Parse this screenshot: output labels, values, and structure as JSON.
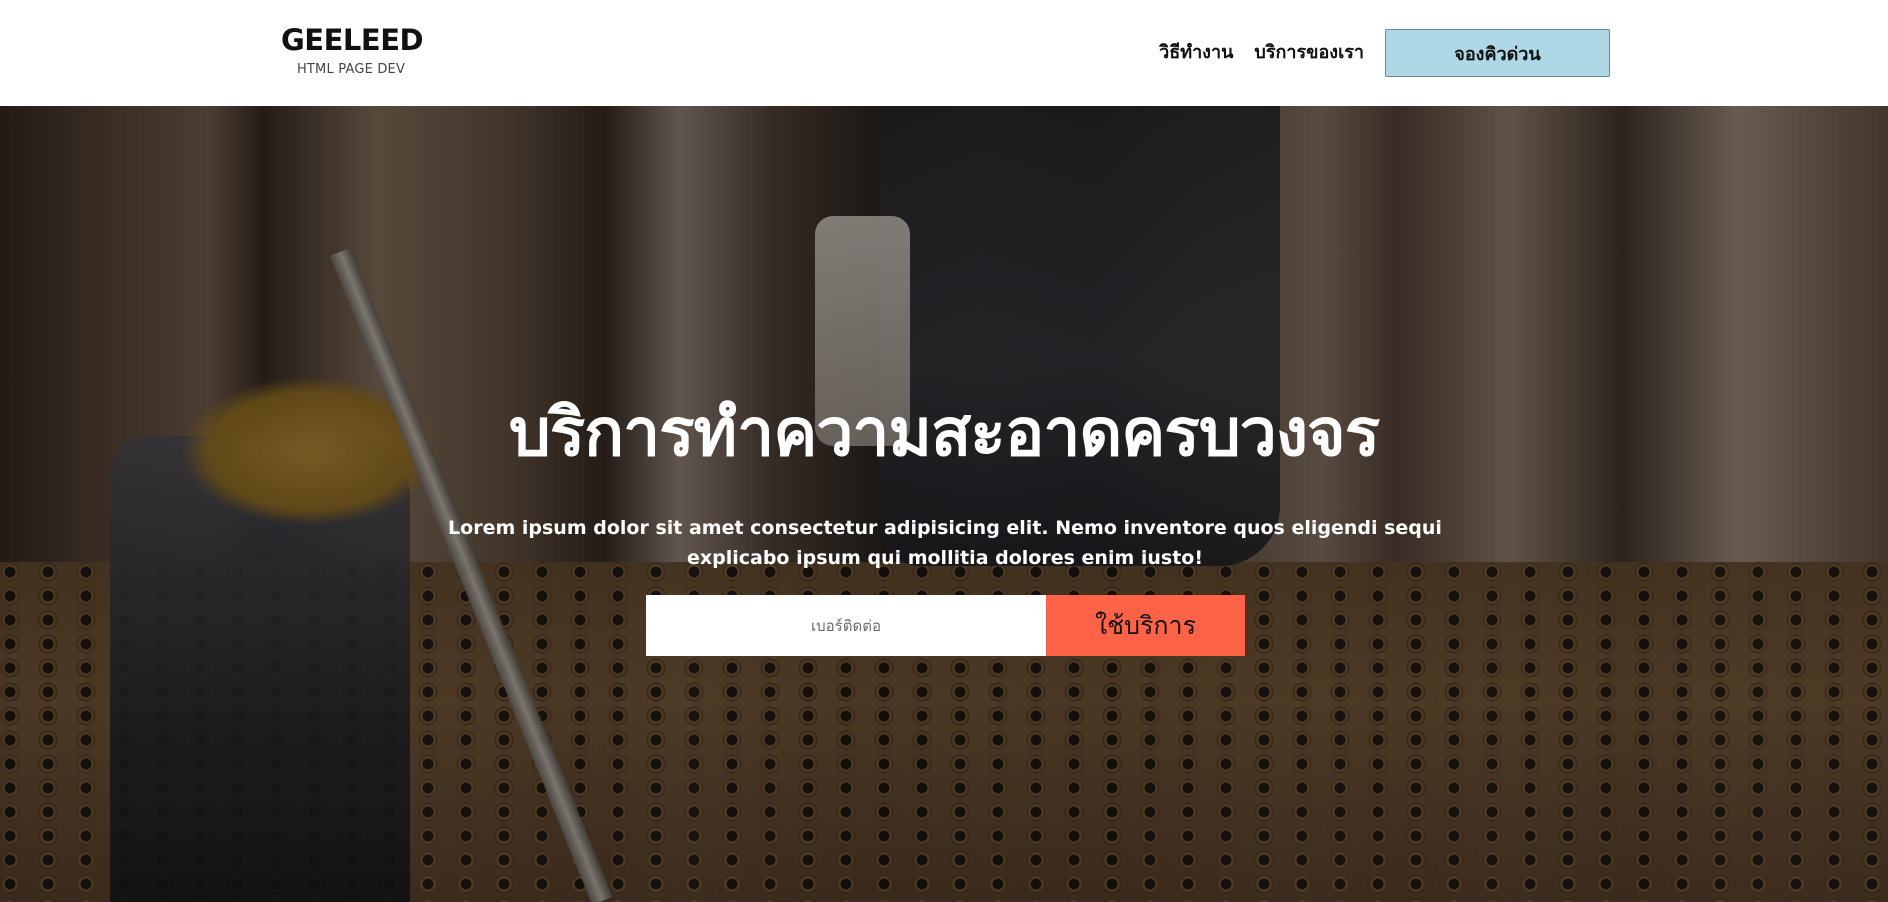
{
  "header": {
    "brand_name": "GEELEED",
    "brand_sub": "HTML PAGE DEV",
    "nav": [
      {
        "label": "วิธีทำงาน"
      },
      {
        "label": "บริการของเรา"
      }
    ],
    "cta_label": "จองคิวด่วน"
  },
  "hero": {
    "title": "บริการทำความสะอาดครบวงจร",
    "description": "Lorem ipsum dolor sit amet consectetur adipisicing elit. Nemo inventore quos eligendi sequi explicabo ipsum qui mollitia dolores enim iusto!",
    "phone_placeholder": "เบอร์ติดต่อ",
    "submit_label": "ใช้บริการ"
  },
  "colors": {
    "cta_bg": "#aed8e6",
    "submit_bg": "#ff6347"
  }
}
